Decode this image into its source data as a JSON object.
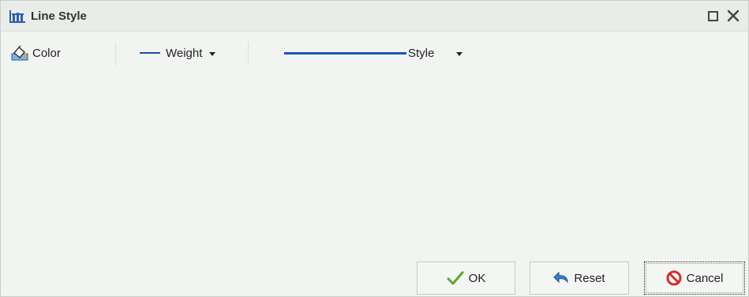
{
  "window": {
    "title": "Line Style"
  },
  "titlebar": {
    "maximize_icon": "maximize-icon",
    "close_label": "x"
  },
  "toolbar": {
    "color_label": "Color",
    "weight_label": "Weight",
    "style_label": "Style",
    "line_color": "#1a56b8"
  },
  "footer": {
    "ok_label": "OK",
    "reset_label": "Reset",
    "cancel_label": "Cancel"
  }
}
